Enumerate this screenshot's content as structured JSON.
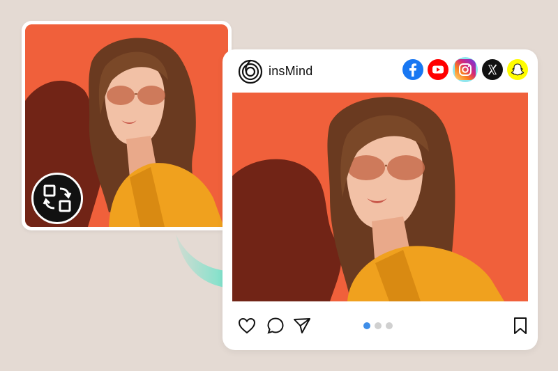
{
  "colors": {
    "background": "#e4dad3",
    "photo_backdrop": "#f0603b",
    "arrow": "#38e8c6",
    "dot_active": "#3f8ee8",
    "dot_inactive": "#d0d0d0"
  },
  "original": {
    "photo_icon": "portrait-photo",
    "badge_icon": "resize-swap-icon"
  },
  "post": {
    "brand_name": "insMind",
    "brand_icon": "insmind-logo-icon",
    "socials": [
      {
        "name": "facebook",
        "icon": "facebook-icon",
        "color": "#1877f2",
        "active": false
      },
      {
        "name": "youtube",
        "icon": "youtube-icon",
        "color": "#ff0000",
        "active": false
      },
      {
        "name": "instagram",
        "icon": "instagram-icon",
        "color": "#d62976",
        "active": true
      },
      {
        "name": "x",
        "icon": "x-icon",
        "color": "#111111",
        "active": false
      },
      {
        "name": "snapchat",
        "icon": "snapchat-icon",
        "color": "#fffc00",
        "active": false
      }
    ],
    "actions": [
      "heart-icon",
      "comment-icon",
      "share-icon",
      "bookmark-icon"
    ],
    "carousel": {
      "count": 3,
      "active_index": 0
    }
  }
}
